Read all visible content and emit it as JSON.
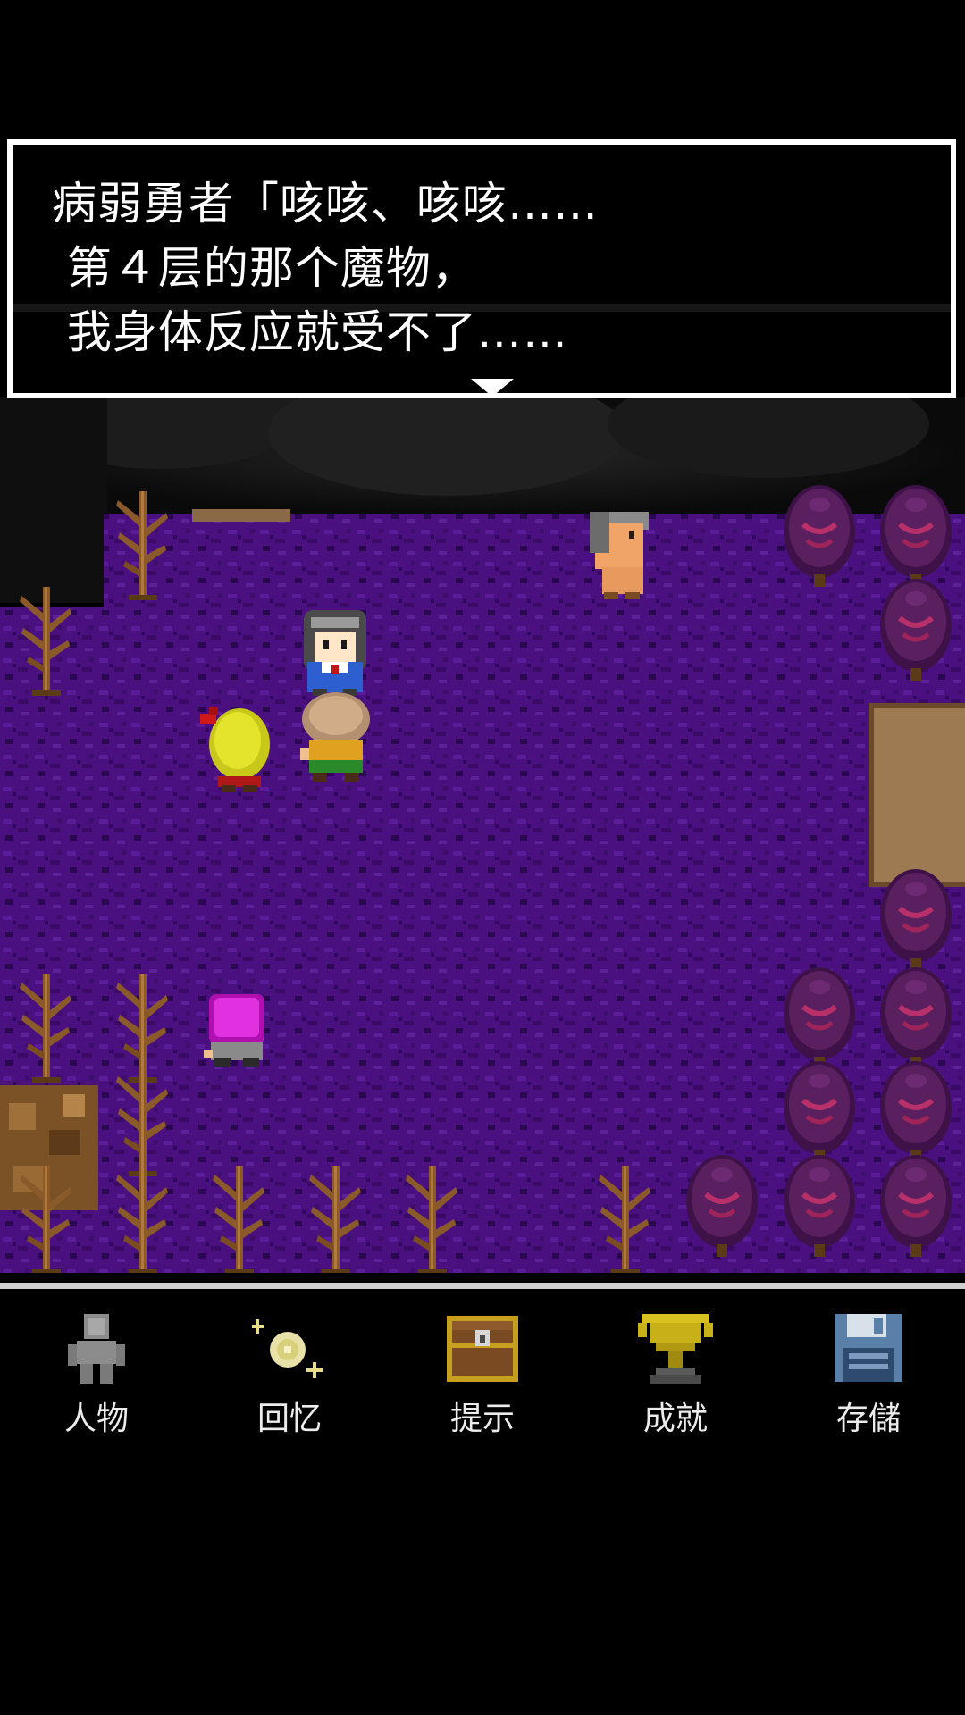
{
  "dialog": {
    "lines": [
      "病弱勇者「咳咳、咳咳……",
      " 第４层的那个魔物，",
      " 我身体反应就受不了……"
    ]
  },
  "menu": {
    "items": [
      {
        "label": "人物",
        "icon": "character-silhouette-icon"
      },
      {
        "label": "回忆",
        "icon": "sparkle-memory-icon"
      },
      {
        "label": "提示",
        "icon": "treasure-chest-icon"
      },
      {
        "label": "成就",
        "icon": "gold-trophy-icon"
      },
      {
        "label": "存儲",
        "icon": "floppy-disk-save-icon"
      }
    ]
  },
  "colors": {
    "ground_purple": "#4a1080",
    "dead_tree": "#8a5a2a",
    "dark_tree": "#5a1f5f",
    "dialog_border": "#ffffff",
    "menu_divider": "#cfcfcf"
  }
}
